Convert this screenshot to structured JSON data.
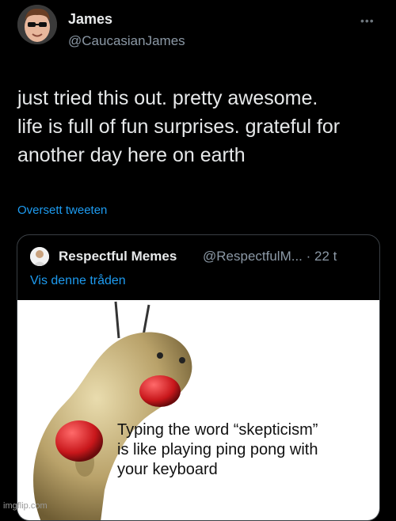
{
  "tweet": {
    "display_name": "James",
    "handle": "@CaucasianJames",
    "more_label": "•••",
    "text_lines": [
      "just tried this out. pretty awesome.",
      "life is full of fun surprises. grateful for",
      "another day here on earth"
    ],
    "translate_label": "Oversett tweeten"
  },
  "quote": {
    "display_name": "Respectful Memes",
    "handle_time": "@RespectfulM... · 22 t",
    "show_thread_label": "Vis denne tråden",
    "meme_caption_lines": [
      "Typing the word “skepticism”",
      "is like playing ping pong with",
      "your keyboard"
    ]
  },
  "watermark": "imgflip.com",
  "colors": {
    "background": "#000000",
    "link": "#1d9bf0",
    "secondary_text": "#8b98a5",
    "primary_text": "#e7e9ea"
  }
}
